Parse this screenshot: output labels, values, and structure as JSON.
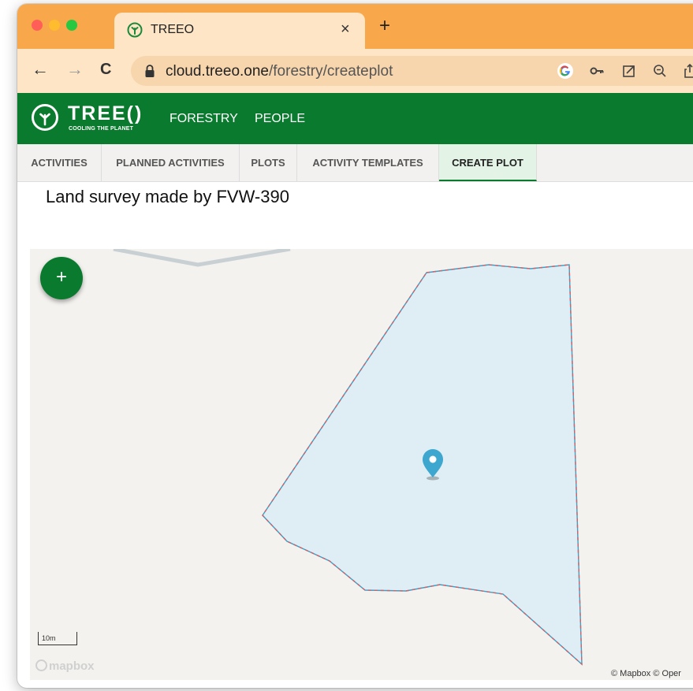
{
  "browser": {
    "tab_title": "TREEO",
    "tab_close": "×",
    "new_tab": "+",
    "url_host": "cloud.treeo.one",
    "url_path": "/forestry/createplot",
    "nav_back": "←",
    "nav_forward": "→",
    "nav_reload": "C"
  },
  "app": {
    "logo_word": "TREE()",
    "logo_tagline": "COOLING THE PLANET",
    "nav": [
      "FORESTRY",
      "PEOPLE"
    ]
  },
  "subnav": {
    "tabs": [
      "ACTIVITIES",
      "PLANNED ACTIVITIES",
      "PLOTS",
      "ACTIVITY TEMPLATES",
      "CREATE PLOT"
    ],
    "active": "CREATE PLOT"
  },
  "page": {
    "title": "Land survey made by FVW-390"
  },
  "map": {
    "fab_label": "+",
    "scale_label": "10m",
    "mapbox_label": "mapbox",
    "attribution": "© Mapbox © Oper"
  },
  "colors": {
    "titlebar": "#f8a84a",
    "brand_green": "#0a7a2e",
    "polygon_fill": "#dfeef4",
    "polygon_stroke": "#c0606e",
    "marker": "#3ea7d0"
  },
  "icons": {
    "tab_favicon": "treeo-logo-icon",
    "lock": "lock-icon",
    "google": "google-icon",
    "key": "key-icon",
    "open_external": "open-external-icon",
    "zoom": "zoom-out-icon",
    "share": "share-icon",
    "marker": "map-marker-icon"
  }
}
